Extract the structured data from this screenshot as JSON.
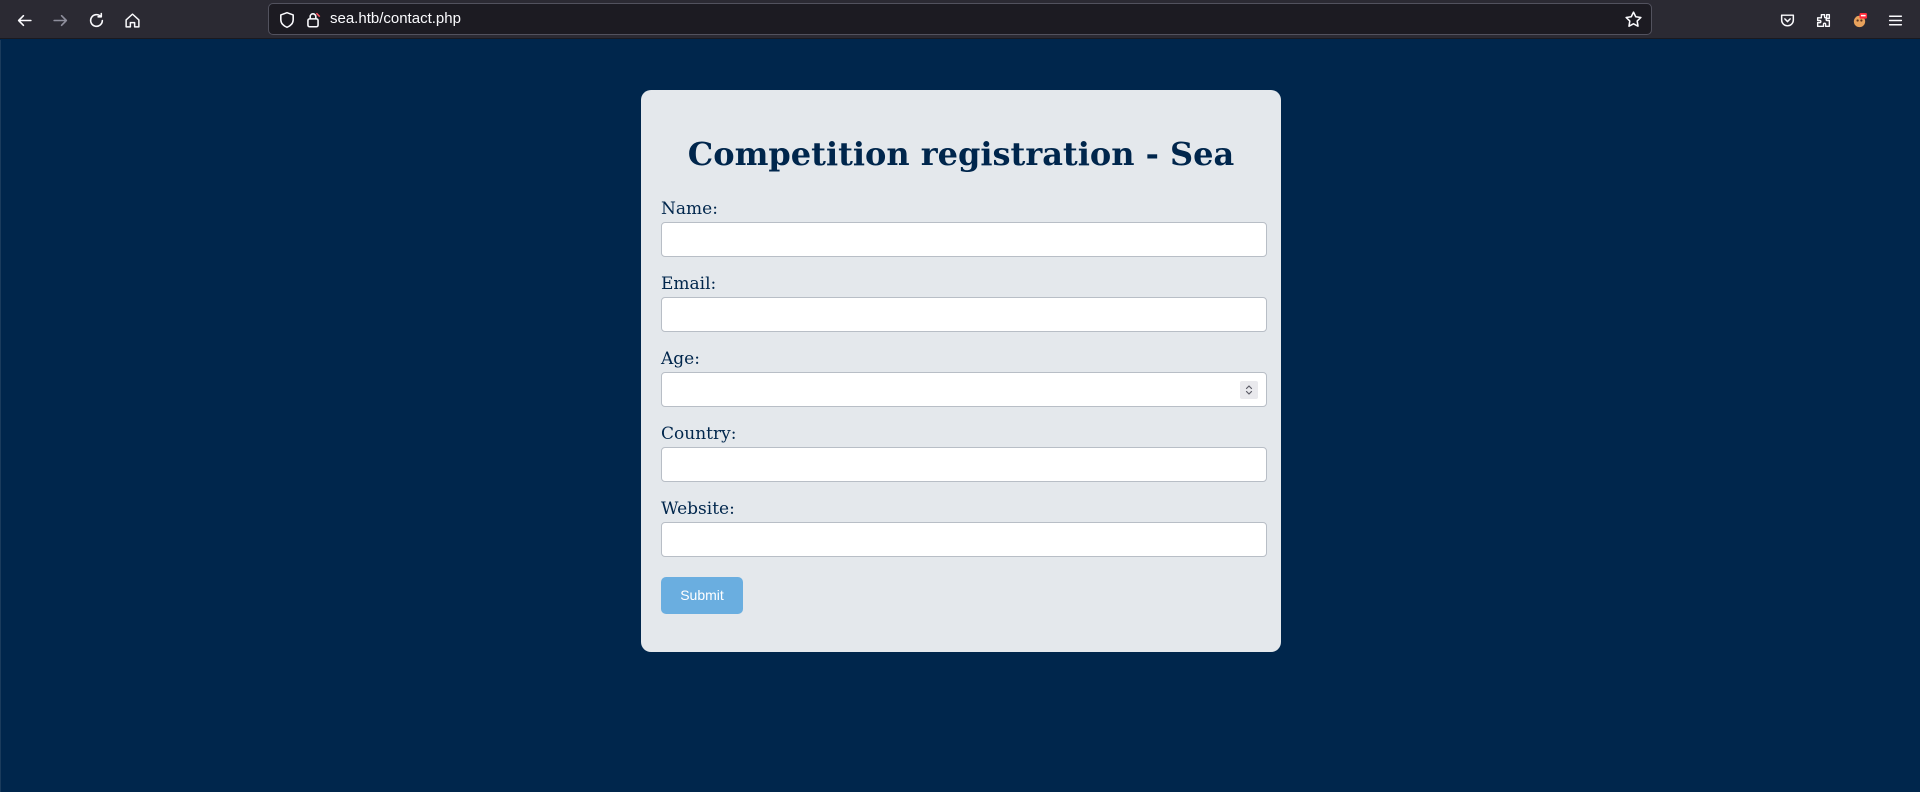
{
  "browser": {
    "url": "sea.htb/contact.php",
    "icons": {
      "back": "back-arrow-icon",
      "forward": "forward-arrow-icon",
      "reload": "reload-icon",
      "home": "home-icon",
      "tracking": "shield-icon",
      "lock": "lock-icon",
      "bookmark": "star-icon",
      "pocket": "pocket-icon",
      "extensions": "extensions-icon",
      "profile": "profile-icon",
      "menu": "hamburger-menu-icon"
    }
  },
  "page": {
    "title": "Competition registration - Sea",
    "fields": [
      {
        "label": "Name:",
        "value": ""
      },
      {
        "label": "Email:",
        "value": ""
      },
      {
        "label": "Age:",
        "value": ""
      },
      {
        "label": "Country:",
        "value": ""
      },
      {
        "label": "Website:",
        "value": ""
      }
    ],
    "submit_label": "Submit"
  },
  "colors": {
    "background": "#00264c",
    "card": "#e4e8ec",
    "heading": "#00264c",
    "submit": "#6aaee0"
  }
}
